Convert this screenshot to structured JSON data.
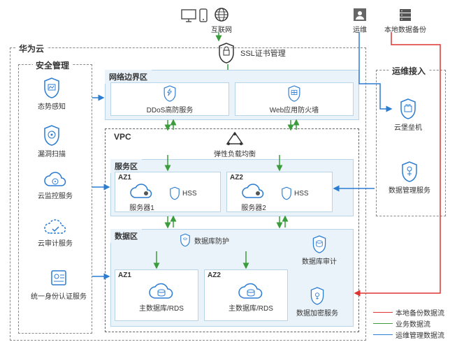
{
  "top": {
    "internet": "互联网",
    "ops": "运维",
    "backup": "本地数据备份"
  },
  "ssl": "SSL证书管理",
  "cloud_box": "华为云",
  "security": {
    "title": "安全管理",
    "items": [
      "态势感知",
      "漏洞扫描",
      "云监控服务",
      "云审计服务",
      "统一身份认证服务"
    ]
  },
  "edge": {
    "title": "网络边界区",
    "ddos": "DDoS高防服务",
    "waf": "Web应用防火墙"
  },
  "vpc": {
    "title": "VPC",
    "elb": "弹性负载均衡",
    "service_zone": {
      "title": "服务区",
      "az1": "AZ1",
      "az2": "AZ2",
      "server1": "服务器1",
      "server2": "服务器2",
      "hss": "HSS"
    },
    "data_zone": {
      "title": "数据区",
      "dbss": "数据库防护",
      "audit": "数据库审计",
      "az1": "AZ1",
      "az2": "AZ2",
      "rds": "主数据库/RDS",
      "encrypt": "数据加密服务"
    }
  },
  "ops_access": {
    "title": "运维接入",
    "bastion": "云堡垒机",
    "das": "数据管理服务"
  },
  "legend": {
    "backup": "本地备份数据流",
    "biz": "业务数据流",
    "ops": "运维管理数据流"
  }
}
